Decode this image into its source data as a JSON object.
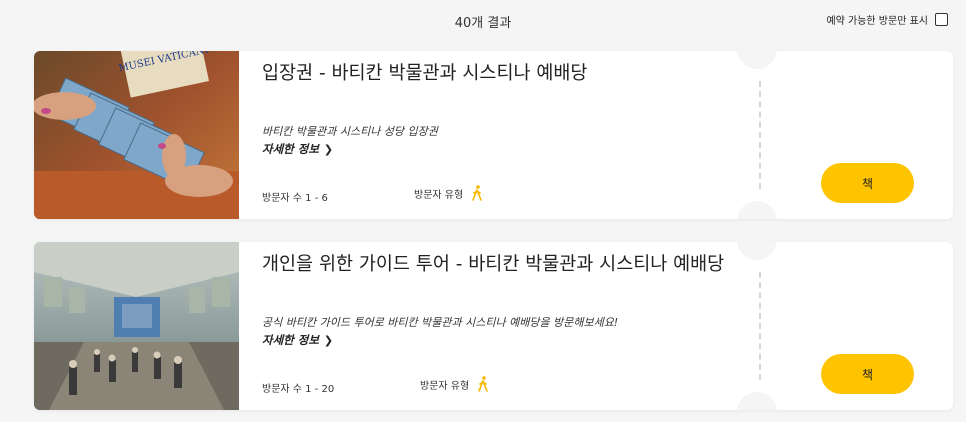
{
  "header": {
    "result_count": "40개 결과",
    "filter_label": "예약 가능한 방문만 표시",
    "filter_checked": false
  },
  "cards": [
    {
      "title": "입장권 - 바티칸 박물관과 시스티나 예배당",
      "subtitle": "바티칸 박물관과 시스티나 성당 입장권",
      "more_label": "자세한 정보",
      "visitors_label": "방문자 수 1 - 6",
      "visitor_type_label": "방문자 유형",
      "book_label": "책",
      "image": "museum-tickets-photo",
      "image_text": "MUSEI VATICANI"
    },
    {
      "title": "개인을 위한 가이드 투어 - 바티칸 박물관과 시스티나 예배당",
      "subtitle": "공식 바티칸 가이드 투어로 바티칸 박물관과 시스티나 예배당을 방문해보세요!",
      "more_label": "자세한 정보",
      "visitors_label": "방문자 수 1 - 20",
      "visitor_type_label": "방문자 유형",
      "book_label": "책",
      "image": "sistine-chapel-photo"
    }
  ],
  "colors": {
    "accent": "#ffc400",
    "walker_icon": "#f5b800",
    "background": "#f5f5f5"
  },
  "icons": [
    "chevron-right-icon",
    "walking-person-icon",
    "checkbox-icon"
  ]
}
